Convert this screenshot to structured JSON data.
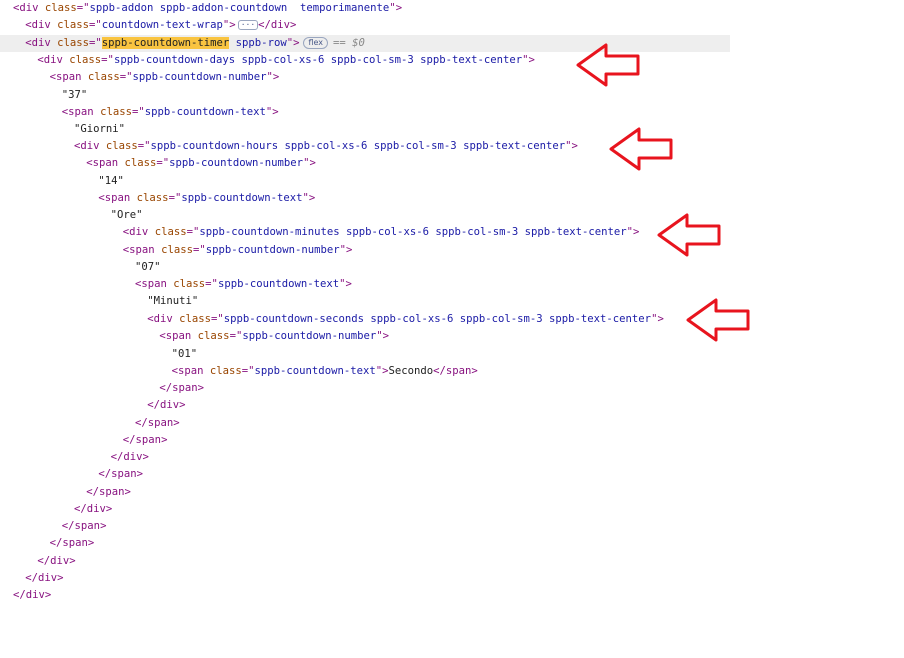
{
  "lines": [
    {
      "toggle": "▼",
      "parts": [
        [
          "tag",
          "<div "
        ],
        [
          "attr",
          "class"
        ],
        [
          "tag",
          "=\""
        ],
        [
          "val",
          "sppb-addon sppb-addon-countdown  temporimanente"
        ],
        [
          "tag",
          "\">"
        ]
      ]
    },
    {
      "toggle": "▶",
      "parts": [
        [
          "tag",
          "<div "
        ],
        [
          "attr",
          "class"
        ],
        [
          "tag",
          "=\""
        ],
        [
          "val",
          "countdown-text-wrap"
        ],
        [
          "tag",
          "\">"
        ],
        [
          "ell",
          "···"
        ],
        [
          "tag",
          "</div>"
        ]
      ]
    },
    {
      "toggle": "▼",
      "selected": true,
      "parts": [
        [
          "tag",
          "<div "
        ],
        [
          "attr",
          "class"
        ],
        [
          "tag",
          "=\""
        ],
        [
          "hl",
          "sppb-countdown-timer"
        ],
        [
          "val",
          " sppb-row"
        ],
        [
          "tag",
          "\">"
        ],
        [
          "badge",
          "flex"
        ],
        [
          "dollar",
          "== $0"
        ]
      ]
    },
    {
      "toggle": "▼",
      "parts": [
        [
          "tag",
          "<div "
        ],
        [
          "attr",
          "class"
        ],
        [
          "tag",
          "=\""
        ],
        [
          "val",
          "sppb-countdown-days sppb-col-xs-6 sppb-col-sm-3 sppb-text-center"
        ],
        [
          "tag",
          "\">"
        ]
      ]
    },
    {
      "toggle": "▼",
      "parts": [
        [
          "tag",
          "<span "
        ],
        [
          "attr",
          "class"
        ],
        [
          "tag",
          "=\""
        ],
        [
          "val",
          "sppb-countdown-number"
        ],
        [
          "tag",
          "\">"
        ]
      ]
    },
    {
      "toggle": "",
      "parts": [
        [
          "txt",
          "\"37\""
        ]
      ]
    },
    {
      "toggle": "▼",
      "parts": [
        [
          "tag",
          "<span "
        ],
        [
          "attr",
          "class"
        ],
        [
          "tag",
          "=\""
        ],
        [
          "val",
          "sppb-countdown-text"
        ],
        [
          "tag",
          "\">"
        ]
      ]
    },
    {
      "toggle": "",
      "parts": [
        [
          "txt",
          "\"Giorni\""
        ]
      ]
    },
    {
      "toggle": "▼",
      "parts": [
        [
          "tag",
          "<div "
        ],
        [
          "attr",
          "class"
        ],
        [
          "tag",
          "=\""
        ],
        [
          "val",
          "sppb-countdown-hours sppb-col-xs-6 sppb-col-sm-3 sppb-text-center"
        ],
        [
          "tag",
          "\">"
        ]
      ]
    },
    {
      "toggle": "▼",
      "parts": [
        [
          "tag",
          "<span "
        ],
        [
          "attr",
          "class"
        ],
        [
          "tag",
          "=\""
        ],
        [
          "val",
          "sppb-countdown-number"
        ],
        [
          "tag",
          "\">"
        ]
      ]
    },
    {
      "toggle": "",
      "parts": [
        [
          "txt",
          "\"14\""
        ]
      ]
    },
    {
      "toggle": "▼",
      "parts": [
        [
          "tag",
          "<span "
        ],
        [
          "attr",
          "class"
        ],
        [
          "tag",
          "=\""
        ],
        [
          "val",
          "sppb-countdown-text"
        ],
        [
          "tag",
          "\">"
        ]
      ]
    },
    {
      "toggle": "",
      "parts": [
        [
          "txt",
          "\"Ore\""
        ]
      ]
    },
    {
      "toggle": "▼",
      "parts": [
        [
          "tag",
          "<div "
        ],
        [
          "attr",
          "class"
        ],
        [
          "tag",
          "=\""
        ],
        [
          "val",
          "sppb-countdown-minutes sppb-col-xs-6 sppb-col-sm-3 sppb-text-center"
        ],
        [
          "tag",
          "\">"
        ]
      ]
    },
    {
      "toggle": "▼",
      "parts": [
        [
          "tag",
          "<span "
        ],
        [
          "attr",
          "class"
        ],
        [
          "tag",
          "=\""
        ],
        [
          "val",
          "sppb-countdown-number"
        ],
        [
          "tag",
          "\">"
        ]
      ]
    },
    {
      "toggle": "",
      "parts": [
        [
          "txt",
          "\"07\""
        ]
      ]
    },
    {
      "toggle": "▼",
      "parts": [
        [
          "tag",
          "<span "
        ],
        [
          "attr",
          "class"
        ],
        [
          "tag",
          "=\""
        ],
        [
          "val",
          "sppb-countdown-text"
        ],
        [
          "tag",
          "\">"
        ]
      ]
    },
    {
      "toggle": "",
      "parts": [
        [
          "txt",
          "\"Minuti\""
        ]
      ]
    },
    {
      "toggle": "▼",
      "parts": [
        [
          "tag",
          "<div "
        ],
        [
          "attr",
          "class"
        ],
        [
          "tag",
          "=\""
        ],
        [
          "val",
          "sppb-countdown-seconds sppb-col-xs-6 sppb-col-sm-3 sppb-text-center"
        ],
        [
          "tag",
          "\">"
        ]
      ]
    },
    {
      "toggle": "▼",
      "parts": [
        [
          "tag",
          "<span "
        ],
        [
          "attr",
          "class"
        ],
        [
          "tag",
          "=\""
        ],
        [
          "val",
          "sppb-countdown-number"
        ],
        [
          "tag",
          "\">"
        ]
      ]
    },
    {
      "toggle": "",
      "parts": [
        [
          "txt",
          "\"01\""
        ]
      ]
    },
    {
      "toggle": "",
      "parts": [
        [
          "tag",
          "<span "
        ],
        [
          "attr",
          "class"
        ],
        [
          "tag",
          "=\""
        ],
        [
          "val",
          "sppb-countdown-text"
        ],
        [
          "tag",
          "\">"
        ],
        [
          "txt",
          "Secondo"
        ],
        [
          "tag",
          "</span>"
        ]
      ]
    },
    {
      "toggle": "",
      "parts": [
        [
          "tag",
          "</span>"
        ]
      ]
    },
    {
      "toggle": "",
      "parts": [
        [
          "tag",
          "</div>"
        ]
      ]
    },
    {
      "toggle": "",
      "parts": [
        [
          "tag",
          "</span>"
        ]
      ]
    },
    {
      "toggle": "",
      "parts": [
        [
          "tag",
          "</span>"
        ]
      ]
    },
    {
      "toggle": "",
      "parts": [
        [
          "tag",
          "</div>"
        ]
      ]
    },
    {
      "toggle": "",
      "parts": [
        [
          "tag",
          "</span>"
        ]
      ]
    },
    {
      "toggle": "",
      "parts": [
        [
          "tag",
          "</span>"
        ]
      ]
    },
    {
      "toggle": "",
      "parts": [
        [
          "tag",
          "</div>"
        ]
      ]
    },
    {
      "toggle": "",
      "parts": [
        [
          "tag",
          "</span>"
        ]
      ]
    },
    {
      "toggle": "",
      "parts": [
        [
          "tag",
          "</span>"
        ]
      ]
    },
    {
      "toggle": "",
      "parts": [
        [
          "tag",
          "</div>"
        ]
      ]
    },
    {
      "toggle": "",
      "parts": [
        [
          "tag",
          "</div>"
        ]
      ]
    },
    {
      "toggle": "",
      "parts": [
        [
          "tag",
          "</div>"
        ]
      ]
    }
  ],
  "annotation_color": "#e8141e"
}
